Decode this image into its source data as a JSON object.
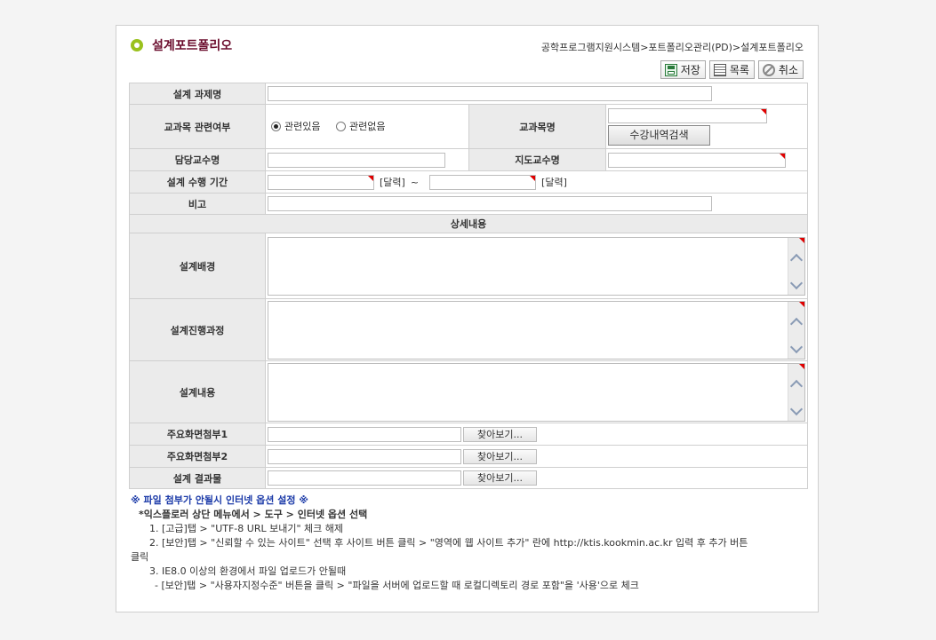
{
  "header": {
    "title": "설계포트폴리오",
    "breadcrumb": "공학프로그램지원시스템>포트폴리오관리(PD)>설계포트폴리오"
  },
  "toolbar": {
    "save": "저장",
    "list": "목록",
    "cancel": "취소"
  },
  "form": {
    "task_name_label": "설계 과제명",
    "course_related_label": "교과목 관련여부",
    "course_related_options": [
      "관련있음",
      "관련없음"
    ],
    "course_related_selected": "관련있음",
    "course_name_label": "교과목명",
    "course_search_button": "수강내역검색",
    "professor_label": "담당교수명",
    "advisor_label": "지도교수명",
    "period_label": "설계 수행 기간",
    "calendar_label": "[달력]",
    "tilde": "~",
    "remark_label": "비고",
    "detail_section": "상세내용",
    "background_label": "설계배경",
    "process_label": "설계진행과정",
    "content_label": "설계내용",
    "attach1_label": "주요화면첨부1",
    "attach2_label": "주요화면첨부2",
    "result_label": "설계 결과물",
    "browse_button": "찾아보기..."
  },
  "notes": {
    "heading": "※ 파일 첨부가 안될시 인터넷 옵션 설정 ※",
    "subheading": "*익스플로러 상단 메뉴에서 > 도구 > 인터넷 옵션 선택",
    "item1": "1. [고급]탭 > \"UTF-8 URL 보내기\" 체크 해제",
    "item2": "2. [보안]탭 > \"신뢰할 수 있는 사이트\" 선택 후 사이트 버튼 클릭 > \"영역에 웹 사이트 추가\" 란에 http://ktis.kookmin.ac.kr 입력 후 추가 버튼",
    "item2_cont": "클릭",
    "item3": "3. IE8.0 이상의 환경에서 파일 업로드가 안될때",
    "item3_sub": "- [보안]탭 > \"사용자지정수준\" 버튼을 클릭 > \"파일을 서버에 업로드할 때 로컬디렉토리 경로 포함\"을 '사용'으로 체크"
  },
  "colors": {
    "title": "#6a0c2c",
    "bullet": "#9ac11d",
    "note_heading": "#1b3aa8",
    "required_marker": "#e00000",
    "label_bg": "#ebebeb"
  }
}
